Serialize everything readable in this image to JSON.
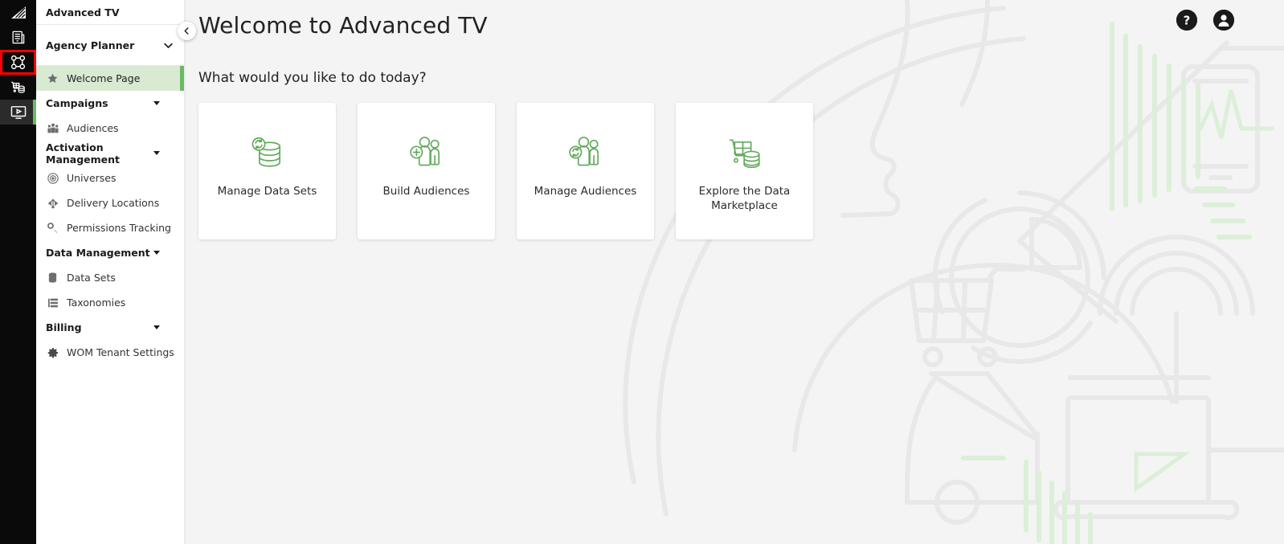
{
  "colors": {
    "accent_green": "#6aba63",
    "active_nav_bg": "#d9ead3",
    "rail_bg": "#0a0a0a",
    "selection_outline": "#ff0000",
    "page_bg": "#f4f4f4",
    "card_bg": "#ffffff",
    "icon_green": "#63ab5c",
    "text_dark": "#222222"
  },
  "rail": {
    "items": [
      {
        "name": "app-logo-icon",
        "label": "Advanced TV Logo",
        "state": "logo"
      },
      {
        "name": "reports-icon",
        "label": "Reports",
        "state": "default"
      },
      {
        "name": "planner-nodes-icon",
        "label": "Agency Planner",
        "state": "selected"
      },
      {
        "name": "marketplace-cart-icon",
        "label": "Data Marketplace",
        "state": "default"
      },
      {
        "name": "media-player-icon",
        "label": "Media",
        "state": "active"
      }
    ]
  },
  "sidebar": {
    "brand": "Advanced TV",
    "selector": {
      "label": "Agency Planner",
      "icon": "chevron-down-icon"
    },
    "collapse_icon": "chevron-left-icon",
    "nav": [
      {
        "type": "item",
        "label": "Welcome Page",
        "icon": "star-icon",
        "active": true
      },
      {
        "type": "group",
        "label": "Campaigns",
        "icon": "caret-down-icon"
      },
      {
        "type": "item",
        "label": "Audiences",
        "icon": "people-group-icon",
        "active": false
      },
      {
        "type": "group",
        "label": "Activation Management",
        "icon": "caret-down-icon"
      },
      {
        "type": "item",
        "label": "Universes",
        "icon": "universe-atom-icon",
        "active": false
      },
      {
        "type": "item",
        "label": "Delivery Locations",
        "icon": "anchor-delivery-icon",
        "active": false
      },
      {
        "type": "item",
        "label": "Permissions Tracking",
        "icon": "key-icon",
        "active": false
      },
      {
        "type": "group",
        "label": "Data Management",
        "icon": "caret-down-icon"
      },
      {
        "type": "item",
        "label": "Data Sets",
        "icon": "database-icon",
        "active": false
      },
      {
        "type": "item",
        "label": "Taxonomies",
        "icon": "taxonomy-layers-icon",
        "active": false
      },
      {
        "type": "group",
        "label": "Billing",
        "icon": "caret-down-icon"
      },
      {
        "type": "item",
        "label": "WOM Tenant Settings",
        "icon": "gear-icon",
        "active": false
      }
    ]
  },
  "header": {
    "title": "Welcome to Advanced TV",
    "subtitle": "What would you like to do today?",
    "actions": [
      {
        "name": "help-icon",
        "glyph": "?",
        "label": "Help"
      },
      {
        "name": "account-icon",
        "glyph": "●",
        "label": "Account"
      }
    ]
  },
  "cards": [
    {
      "label": "Manage Data Sets",
      "icon": "database-refresh-icon"
    },
    {
      "label": "Build Audiences",
      "icon": "add-person-icon"
    },
    {
      "label": "Manage Audiences",
      "icon": "refresh-person-icon"
    },
    {
      "label": "Explore the Data Marketplace",
      "icon": "cart-database-icon"
    }
  ]
}
